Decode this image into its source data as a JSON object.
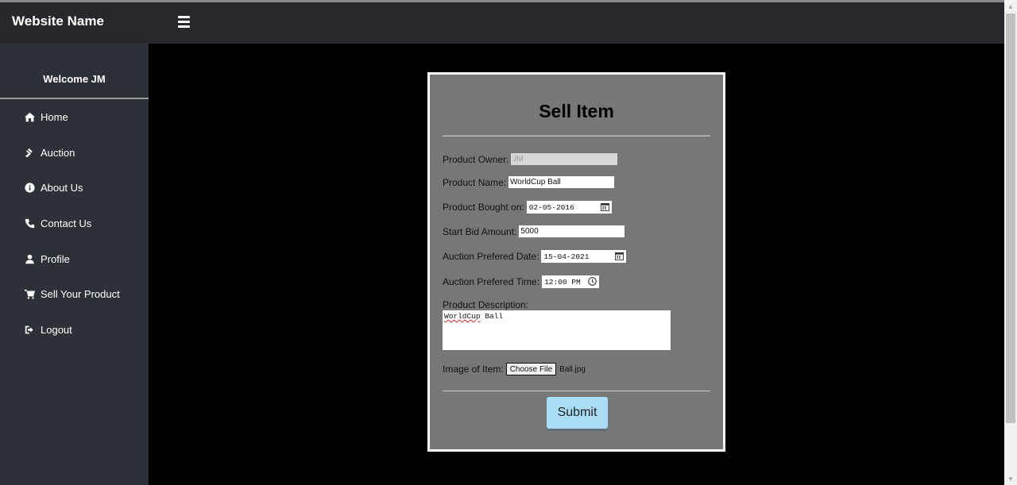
{
  "header": {
    "site_name": "Website Name"
  },
  "sidebar": {
    "welcome": "Welcome JM",
    "items": [
      {
        "label": "Home",
        "icon": "home-icon"
      },
      {
        "label": "Auction",
        "icon": "gavel-icon"
      },
      {
        "label": "About Us",
        "icon": "info-icon"
      },
      {
        "label": "Contact Us",
        "icon": "phone-icon"
      },
      {
        "label": "Profile",
        "icon": "user-icon"
      },
      {
        "label": "Sell Your Product",
        "icon": "cart-icon"
      },
      {
        "label": "Logout",
        "icon": "logout-icon"
      }
    ]
  },
  "form": {
    "title": "Sell Item",
    "owner_label": "Product Owner:",
    "owner_value": "JM",
    "name_label": "Product Name:",
    "name_value": "WorldCup Ball",
    "bought_label": "Product Bought on:",
    "bought_value": "02-05-2016",
    "bid_label": "Start Bid Amount:",
    "bid_value": "5000",
    "auction_date_label": "Auction Prefered Date:",
    "auction_date_value": "15-04-2021",
    "auction_time_label": "Auction Prefered Time:",
    "auction_time_value": "12:00 PM",
    "description_label": "Product Description:",
    "description_word1": "WorldCup",
    "description_word2": "Ball",
    "image_label": "Image of Item:",
    "file_button": "Choose File",
    "file_name": "Ball.jpg",
    "submit_label": "Submit"
  },
  "colors": {
    "submit_bg": "#a8ddf5",
    "card_bg": "#777777",
    "sidebar_bg": "#2e3038"
  }
}
